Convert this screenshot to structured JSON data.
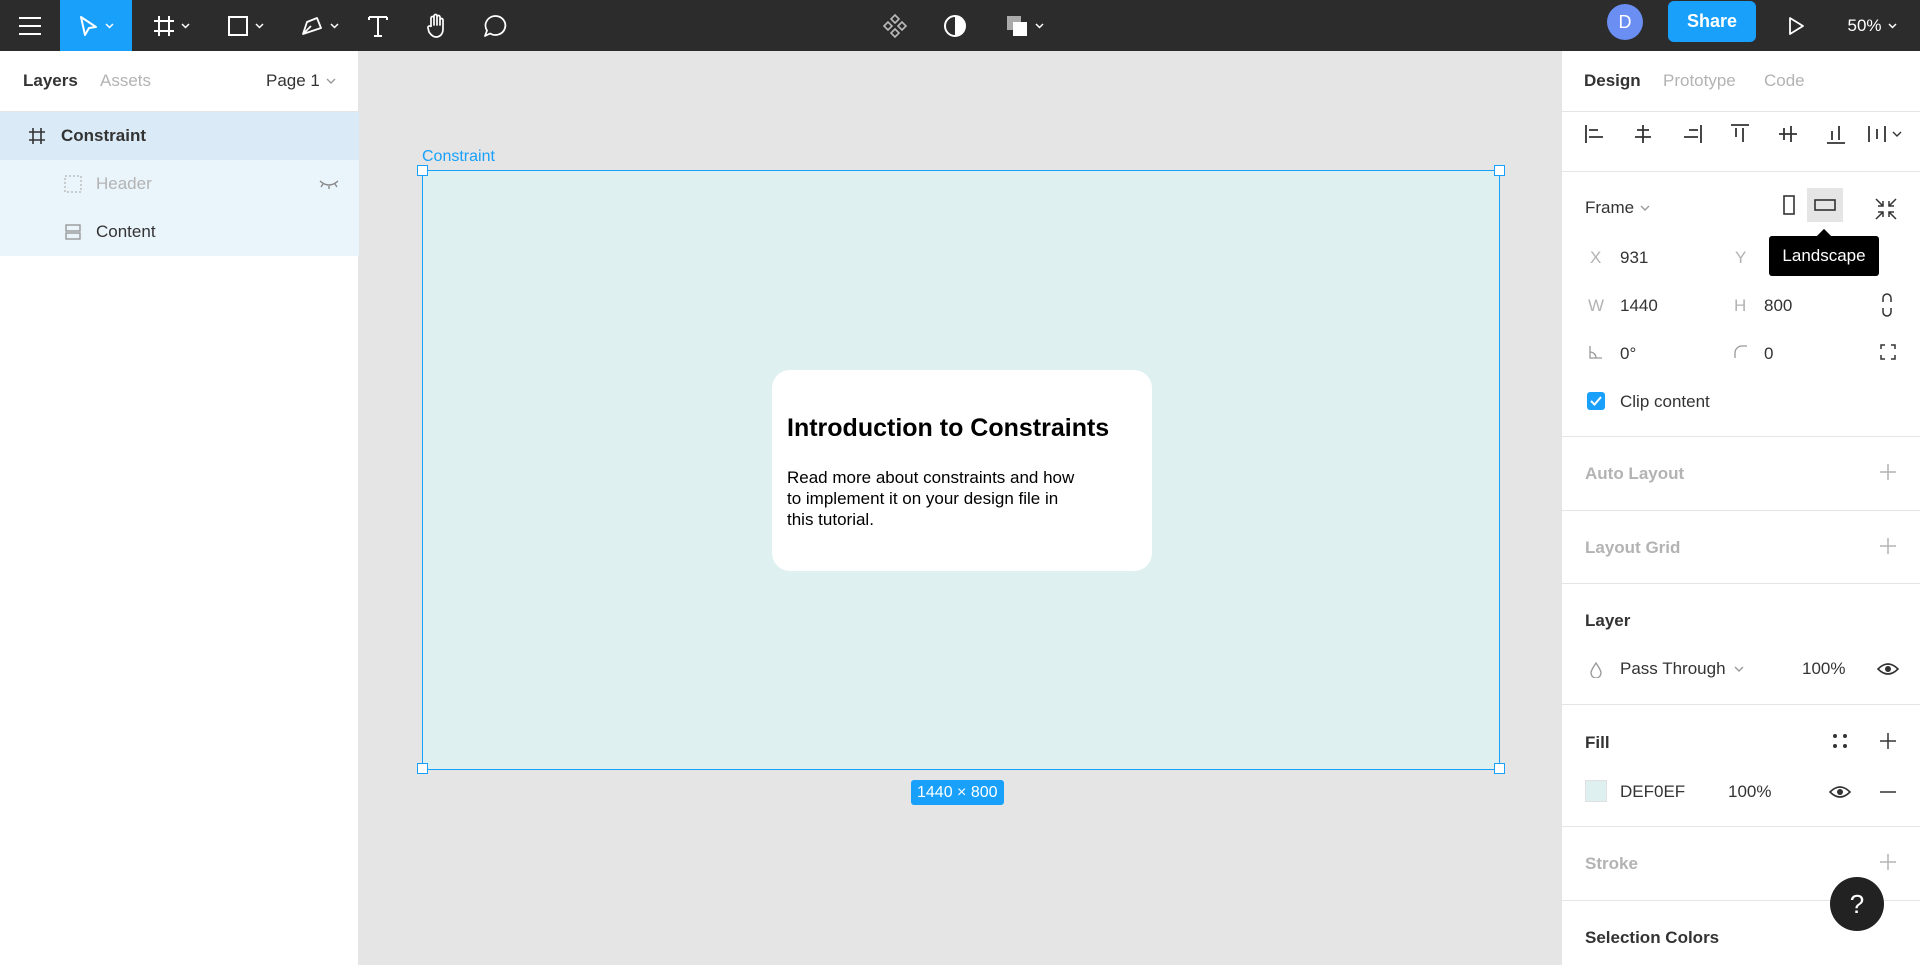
{
  "toolbar": {
    "share_label": "Share",
    "avatar_initial": "D",
    "zoom": "50%",
    "icons": [
      "menu-icon",
      "move-tool-icon",
      "frame-tool-icon",
      "shape-tool-icon",
      "pen-tool-icon",
      "text-tool-icon",
      "hand-tool-icon",
      "comment-tool-icon",
      "component-icon",
      "mask-icon",
      "boolean-icon",
      "play-icon"
    ]
  },
  "left_panel": {
    "tabs": {
      "layers": "Layers",
      "assets": "Assets"
    },
    "page": "Page 1",
    "layers": [
      {
        "name": "Constraint",
        "icon": "frame-icon",
        "selected": true
      },
      {
        "name": "Header",
        "icon": "dashed-frame-icon",
        "hidden": true
      },
      {
        "name": "Content",
        "icon": "auto-layout-icon"
      }
    ]
  },
  "canvas": {
    "frame_label": "Constraint",
    "frame_fill": "#DEF0EF",
    "size_badge": "1440 × 800",
    "card": {
      "title": "Introduction to Constraints",
      "body": "Read more about constraints and how to implement it on your design file in this tutorial."
    }
  },
  "right_panel": {
    "tabs": {
      "design": "Design",
      "prototype": "Prototype",
      "code": "Code"
    },
    "frame_label": "Frame",
    "tooltip": "Landscape",
    "x_label": "X",
    "x_value": "931",
    "y_label": "Y",
    "w_label": "W",
    "w_value": "1440",
    "h_label": "H",
    "h_value": "800",
    "rotation": "0°",
    "radius": "0",
    "clip_content": "Clip content",
    "auto_layout": "Auto Layout",
    "layout_grid": "Layout Grid",
    "layer_title": "Layer",
    "blend_mode": "Pass Through",
    "layer_opacity": "100%",
    "fill_title": "Fill",
    "fill_hex": "DEF0EF",
    "fill_opacity": "100%",
    "stroke_title": "Stroke",
    "selection_colors": "Selection Colors",
    "help": "?"
  },
  "colors": {
    "accent": "#18a0fb",
    "toolbar": "#2c2c2c",
    "frame_fill": "#DEF0EF",
    "selected_row": "#daebf7"
  }
}
